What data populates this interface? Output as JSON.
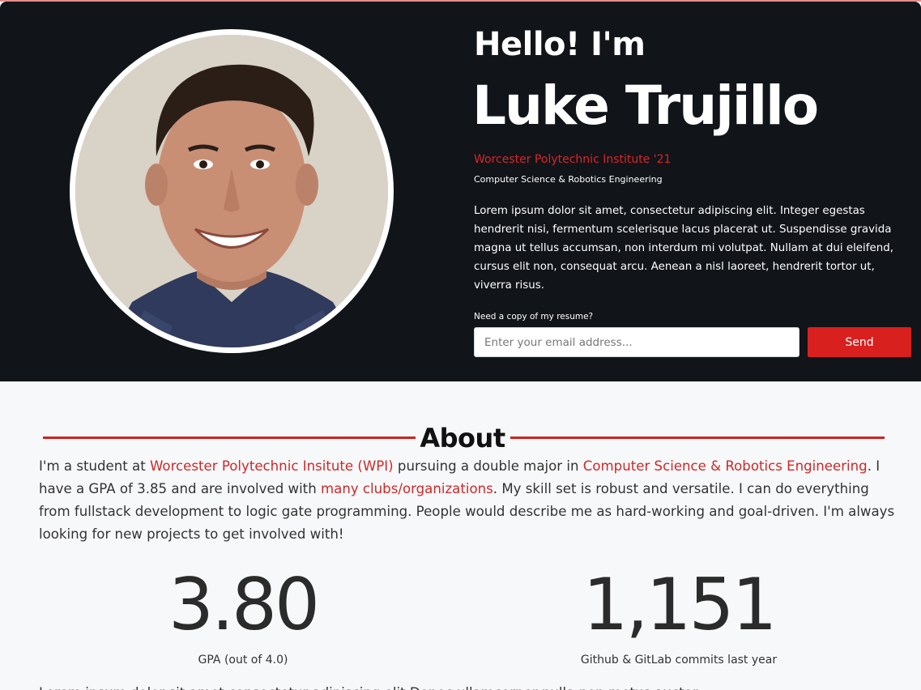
{
  "colors": {
    "hero_background": "#111419",
    "accent": "#d8201f",
    "page_background": "#f7f8fa"
  },
  "hero": {
    "greeting": "Hello! I'm",
    "name": "Luke Trujillo",
    "school": "Worcester Polytechnic Institute '21",
    "major": "Computer Science & Robotics Engineering",
    "bio": "Lorem ipsum dolor sit amet, consectetur adipiscing elit. Integer egestas hendrerit nisi, fermentum scelerisque lacus placerat ut. Suspendisse gravida magna ut tellus accumsan, non interdum mi volutpat. Nullam at dui eleifend, cursus elit non, consequat arcu. Aenean a nisl laoreet, hendrerit tortor ut, viverra risus.",
    "resume_prompt": "Need a copy of my resume?",
    "email_placeholder": "Enter your email address...",
    "send_label": "Send"
  },
  "about": {
    "title": "About",
    "text_1": "I'm a student at ",
    "link_wpi": "Worcester Polytechnic Insitute (WPI)",
    "text_2": " pursuing a double major in ",
    "link_major": "Computer Science & Robotics Engineering",
    "text_3": ". I have a GPA of 3.85 and are involved with ",
    "link_clubs": "many clubs/organizations",
    "text_4": ". My skill set is robust and versatile. I can do everything from fullstack development to logic gate programming. People would describe me as hard-working and goal-driven. I'm always looking for new projects to get involved with!"
  },
  "stats": [
    {
      "value": "3.80",
      "label": "GPA (out of 4.0)"
    },
    {
      "value": "1,151",
      "label": "Github & GitLab commits last year"
    }
  ],
  "cutoff_text": "Lorem ipsum dolor sit amet consectetur adipiscing elit Donec ullamcorper nulla non metus auctor"
}
